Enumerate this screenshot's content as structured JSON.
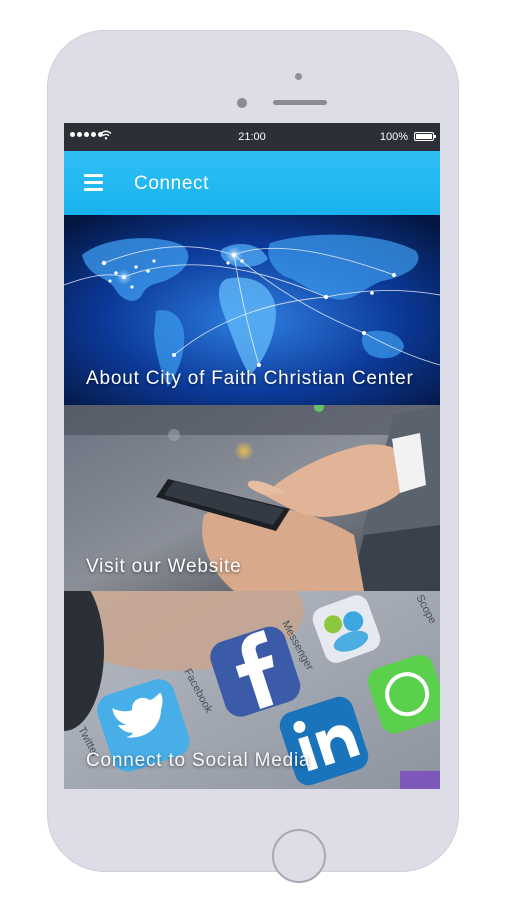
{
  "status_bar": {
    "time": "21:00",
    "battery": "100%"
  },
  "app_bar": {
    "title": "Connect",
    "menu_icon": "hamburger-menu-icon"
  },
  "tiles": [
    {
      "label": "About City of Faith Christian Center",
      "image": "world-map-network"
    },
    {
      "label": "Visit our Website",
      "image": "hands-holding-smartphone"
    },
    {
      "label": "Connect to Social Media",
      "image": "social-app-icons"
    }
  ],
  "social_icons": {
    "facebook": "Facebook",
    "messenger": "Messenger",
    "twitter": "Twitter",
    "scope": "Scope"
  },
  "colors": {
    "app_bar": "#19b2ee",
    "status_bar": "#2d2f36",
    "phone_body": "#dcdde6"
  }
}
